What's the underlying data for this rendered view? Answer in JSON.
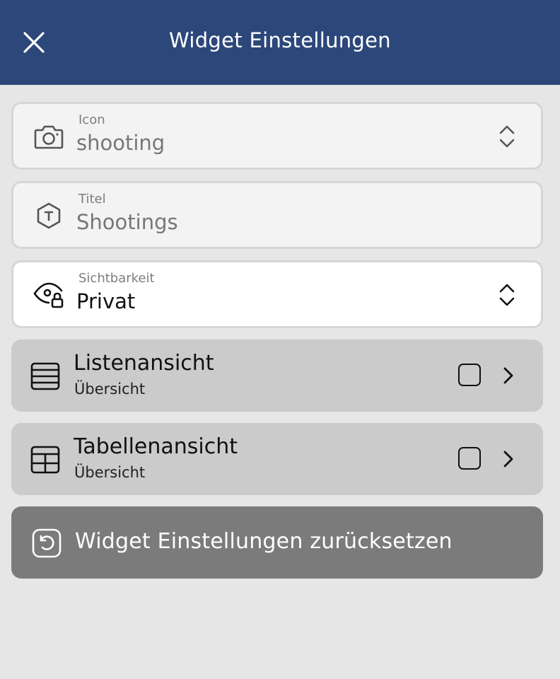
{
  "header": {
    "title": "Widget Einstellungen",
    "close_icon": "close-icon",
    "background": "#2c477a"
  },
  "fields": {
    "icon": {
      "label": "Icon",
      "value": "shooting",
      "icon": "camera-icon",
      "trailing_icon": "chevron-up-down-icon"
    },
    "title": {
      "label": "Titel",
      "value": "Shootings",
      "icon": "title-hexagon-icon"
    },
    "visibility": {
      "label": "Sichtbarkeit",
      "value": "Privat",
      "icon": "eye-lock-icon",
      "trailing_icon": "chevron-up-down-icon"
    }
  },
  "views": [
    {
      "title": "Listenansicht",
      "subtitle": "Übersicht",
      "icon": "list-view-icon",
      "checked": false
    },
    {
      "title": "Tabellenansicht",
      "subtitle": "Übersicht",
      "icon": "table-view-icon",
      "checked": false
    }
  ],
  "reset_button": {
    "label": "Widget Einstellungen zurücksetzen",
    "icon": "reset-icon"
  }
}
